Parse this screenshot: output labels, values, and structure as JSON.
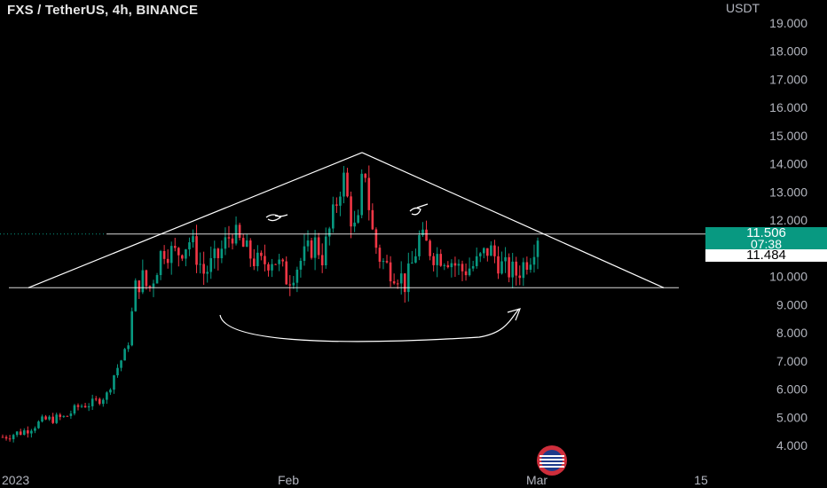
{
  "header": {
    "title": "FXS / TetherUS, 4h, BINANCE",
    "currency": "USDT"
  },
  "price": {
    "last": "11.506",
    "countdown": "07:38",
    "secondary": "11.484"
  },
  "colors": {
    "up": "#089981",
    "down": "#f23645",
    "line": "#ffffff",
    "axis_text": "#b2b5be"
  },
  "chart_data": {
    "type": "candlestick",
    "title": "FXS / TetherUS, 4h, BINANCE",
    "ylabel": "USDT",
    "y_ticks": [
      "4.000",
      "5.000",
      "6.000",
      "7.000",
      "8.000",
      "9.000",
      "10.000",
      "11.000",
      "12.000",
      "13.000",
      "14.000",
      "15.000",
      "16.000",
      "17.000",
      "18.000",
      "19.000"
    ],
    "x_ticks": [
      "2023",
      "Feb",
      "Mar",
      "15"
    ],
    "ylim": [
      3.5,
      19.6
    ],
    "last_price": 11.506,
    "price_path": [
      [
        0,
        4.3
      ],
      [
        6,
        4.5
      ],
      [
        12,
        4.9
      ],
      [
        18,
        5.0
      ],
      [
        22,
        5.4
      ],
      [
        26,
        5.5
      ],
      [
        30,
        5.8
      ],
      [
        32,
        6.5
      ],
      [
        34,
        7.0
      ],
      [
        36,
        7.5
      ],
      [
        38,
        9.5
      ],
      [
        40,
        10.0
      ],
      [
        42,
        9.5
      ],
      [
        44,
        10.2
      ],
      [
        46,
        11.0
      ],
      [
        50,
        10.8
      ],
      [
        54,
        11.3
      ],
      [
        58,
        10.1
      ],
      [
        62,
        10.7
      ],
      [
        66,
        11.6
      ],
      [
        70,
        10.9
      ],
      [
        74,
        10.4
      ],
      [
        78,
        10.7
      ],
      [
        82,
        9.9
      ],
      [
        86,
        10.6
      ],
      [
        90,
        11.2
      ],
      [
        92,
        10.7
      ],
      [
        94,
        11.6
      ],
      [
        96,
        12.6
      ],
      [
        98,
        13.6
      ],
      [
        100,
        12.2
      ],
      [
        102,
        11.4
      ],
      [
        104,
        14.2
      ],
      [
        106,
        11.8
      ],
      [
        108,
        10.8
      ],
      [
        110,
        10.4
      ],
      [
        114,
        10.1
      ],
      [
        116,
        9.7
      ],
      [
        118,
        10.5
      ],
      [
        120,
        11.4
      ],
      [
        124,
        10.8
      ],
      [
        128,
        10.7
      ],
      [
        132,
        10.2
      ],
      [
        136,
        10.4
      ],
      [
        140,
        11.0
      ],
      [
        144,
        10.3
      ],
      [
        148,
        10.1
      ],
      [
        152,
        10.8
      ],
      [
        154,
        11.5
      ]
    ],
    "annotations": [
      {
        "type": "trendline",
        "from": [
          8,
          9.6
        ],
        "to": [
          104,
          14.4
        ]
      },
      {
        "type": "trendline",
        "from": [
          104,
          14.4
        ],
        "to": [
          190,
          9.6
        ]
      },
      {
        "type": "hline",
        "y": 11.506
      },
      {
        "type": "hline",
        "y": 9.6
      },
      {
        "type": "curved_arrow"
      }
    ]
  },
  "icons": {
    "flag": "flag-icon"
  }
}
